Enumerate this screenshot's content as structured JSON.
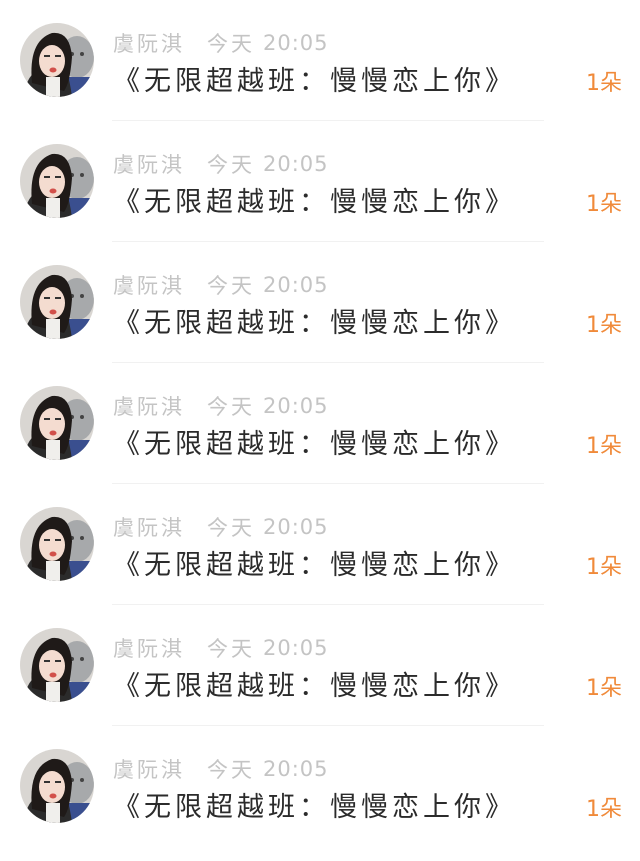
{
  "colors": {
    "meta_text": "#c4c4c4",
    "title_text": "#2b2b2b",
    "count_accent": "#f08a3a",
    "divider": "#f1f1f1"
  },
  "items": [
    {
      "author": "虞阮淇",
      "day": "今天",
      "time": "20:05",
      "title": "《无限超越班：慢慢恋上你》",
      "count": "1朵",
      "avatar_icon": "user-avatar-icon"
    },
    {
      "author": "虞阮淇",
      "day": "今天",
      "time": "20:05",
      "title": "《无限超越班：慢慢恋上你》",
      "count": "1朵",
      "avatar_icon": "user-avatar-icon"
    },
    {
      "author": "虞阮淇",
      "day": "今天",
      "time": "20:05",
      "title": "《无限超越班：慢慢恋上你》",
      "count": "1朵",
      "avatar_icon": "user-avatar-icon"
    },
    {
      "author": "虞阮淇",
      "day": "今天",
      "time": "20:05",
      "title": "《无限超越班：慢慢恋上你》",
      "count": "1朵",
      "avatar_icon": "user-avatar-icon"
    },
    {
      "author": "虞阮淇",
      "day": "今天",
      "time": "20:05",
      "title": "《无限超越班：慢慢恋上你》",
      "count": "1朵",
      "avatar_icon": "user-avatar-icon"
    },
    {
      "author": "虞阮淇",
      "day": "今天",
      "time": "20:05",
      "title": "《无限超越班：慢慢恋上你》",
      "count": "1朵",
      "avatar_icon": "user-avatar-icon"
    },
    {
      "author": "虞阮淇",
      "day": "今天",
      "time": "20:05",
      "title": "《无限超越班：慢慢恋上你》",
      "count": "1朵",
      "avatar_icon": "user-avatar-icon"
    }
  ]
}
